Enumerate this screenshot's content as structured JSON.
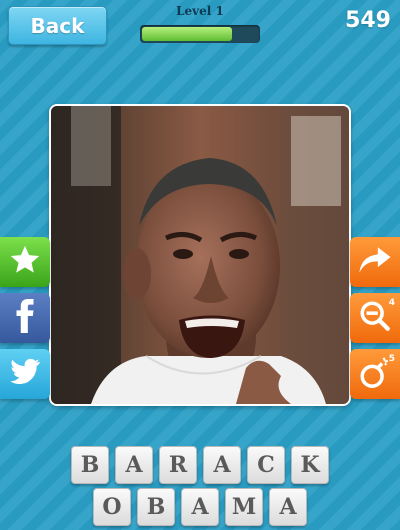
{
  "header": {
    "back_label": "Back",
    "level_label": "Level 1",
    "progress_fraction": 0.78,
    "score": "549"
  },
  "side_buttons": {
    "left": [
      "star-icon",
      "facebook-icon",
      "twitter-icon"
    ],
    "right": [
      "redo-arrow-icon",
      "reveal-letter-icon",
      "bomb-icon"
    ]
  },
  "hints": {
    "reveal_count": "4",
    "bomb_count": "5"
  },
  "answer": {
    "rows": [
      [
        "B",
        "A",
        "R",
        "A",
        "C",
        "K"
      ],
      [
        "O",
        "B",
        "A",
        "M",
        "A"
      ]
    ]
  },
  "colors": {
    "background": "#2a9fc6",
    "progress_fill": "#5fbd34",
    "hint_orange": "#f06a0c",
    "star_green": "#3aa419"
  }
}
